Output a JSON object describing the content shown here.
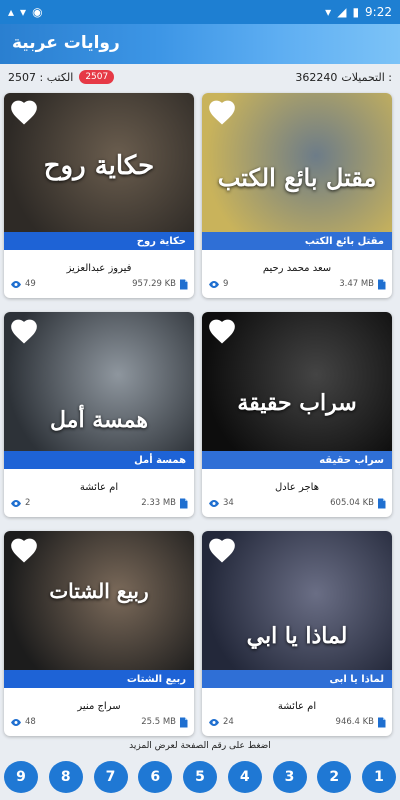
{
  "status": {
    "time": "9:22",
    "left_icons": [
      "upload-icon",
      "download-icon",
      "notification-icon"
    ],
    "right_icons": [
      "wifi-icon",
      "signal-icon",
      "battery-icon"
    ]
  },
  "appbar": {
    "title": "روايات عربية"
  },
  "stats": {
    "books_label": "الكتب : 2507",
    "books_badge": "2507",
    "downloads_label": "التحميلات :",
    "downloads_value": "362240"
  },
  "books": [
    {
      "title": "حكاية روح",
      "author": "فيروز عبدالعزيز",
      "views": "49",
      "size": "957.29 KB",
      "cover_title": "حكاية روح",
      "colors": [
        "#2e2a26",
        "#6a5d4e"
      ],
      "band": "#1e63d6"
    },
    {
      "title": "مقتل بائع الكتب",
      "author": "سعد محمد رحيم",
      "views": "9",
      "size": "3.47 MB",
      "cover_title": "مقتل بائع الكتب",
      "colors": [
        "#c9b35b",
        "#6d7c88"
      ],
      "band": "#2f6fd6"
    },
    {
      "title": "همسة أمل",
      "author": "ام عائشة",
      "views": "2",
      "size": "2.33 MB",
      "cover_title": "همسة أمل",
      "colors": [
        "#2d3238",
        "#8e969e"
      ],
      "band": "#1e63d6"
    },
    {
      "title": "سراب حقيقه",
      "author": "هاجر عادل",
      "views": "34",
      "size": "605.04 KB",
      "cover_title": "سراب حقيقة",
      "colors": [
        "#0d0d0d",
        "#444"
      ],
      "band": "#2f6fd6"
    },
    {
      "title": "ربيع الشتات",
      "author": "سراج منير",
      "views": "48",
      "size": "25.5 MB",
      "cover_title": "ربيع الشتات",
      "colors": [
        "#1c1c1c",
        "#7b6a5a"
      ],
      "band": "#1e63d6"
    },
    {
      "title": "لماذا يا ابى",
      "author": "ام عائشة",
      "views": "24",
      "size": "946.4 KB",
      "cover_title": "لماذا يا ابي",
      "colors": [
        "#23283a",
        "#6a6e85"
      ],
      "band": "#2f6fd6"
    }
  ],
  "hint": "اضغط على رقم الصفحة لعرض المزيد",
  "pages": [
    "9",
    "8",
    "7",
    "6",
    "5",
    "4",
    "3",
    "2",
    "1"
  ]
}
